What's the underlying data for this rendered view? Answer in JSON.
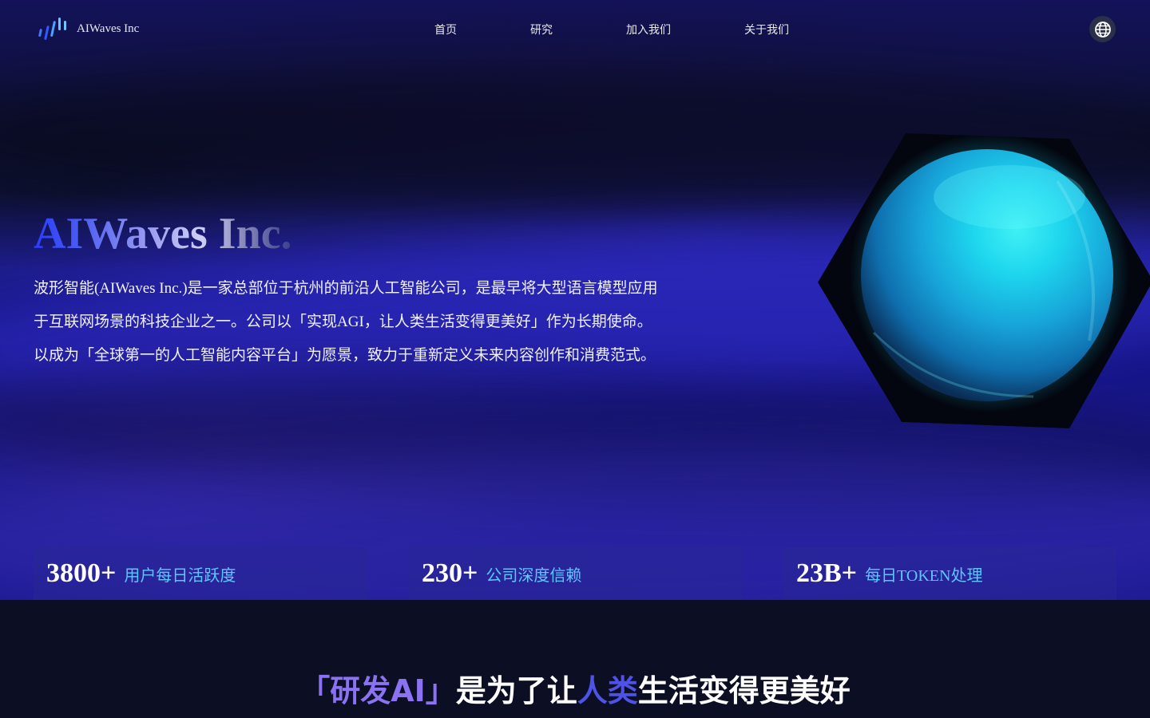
{
  "brand": {
    "name": "AIWaves Inc",
    "logo_colors": [
      "#3b7bff",
      "#2f5cff",
      "#4aa3ff",
      "#6ec5ff"
    ]
  },
  "nav": {
    "items": [
      {
        "label": "首页"
      },
      {
        "label": "研究"
      },
      {
        "label": "加入我们"
      },
      {
        "label": "关于我们"
      }
    ],
    "language_icon": "globe-icon"
  },
  "hero": {
    "title": "AIWaves Inc.",
    "description_lines": [
      "波形智能(AIWaves Inc.)是一家总部位于杭州的前沿人工智能公司，是最早将大型语言模型应用",
      "于互联网场景的科技企业之一。公司以「实现AGI，让人类生活变得更美好」作为长期使命。",
      "以成为「全球第一的人工智能内容平台」为愿景，致力于重新定义未来内容创作和消费范式。"
    ],
    "visual": "glowing-sphere-in-hexagon"
  },
  "stats": [
    {
      "value": "3800+",
      "label": "用户每日活跃度"
    },
    {
      "value": "230+",
      "label": "公司深度信赖"
    },
    {
      "value": "23B+",
      "label": "每日TOKEN处理"
    }
  ],
  "slogan": {
    "part1": "「研发AI」",
    "part2": "是为了让",
    "part3": "人类",
    "part4": "生活变得更美好"
  },
  "colors": {
    "accent_blue": "#5fc6ff",
    "slogan_purple": "#8a72f2",
    "slogan_indigo": "#4f52e6",
    "page_dark": "#0c0e23"
  }
}
